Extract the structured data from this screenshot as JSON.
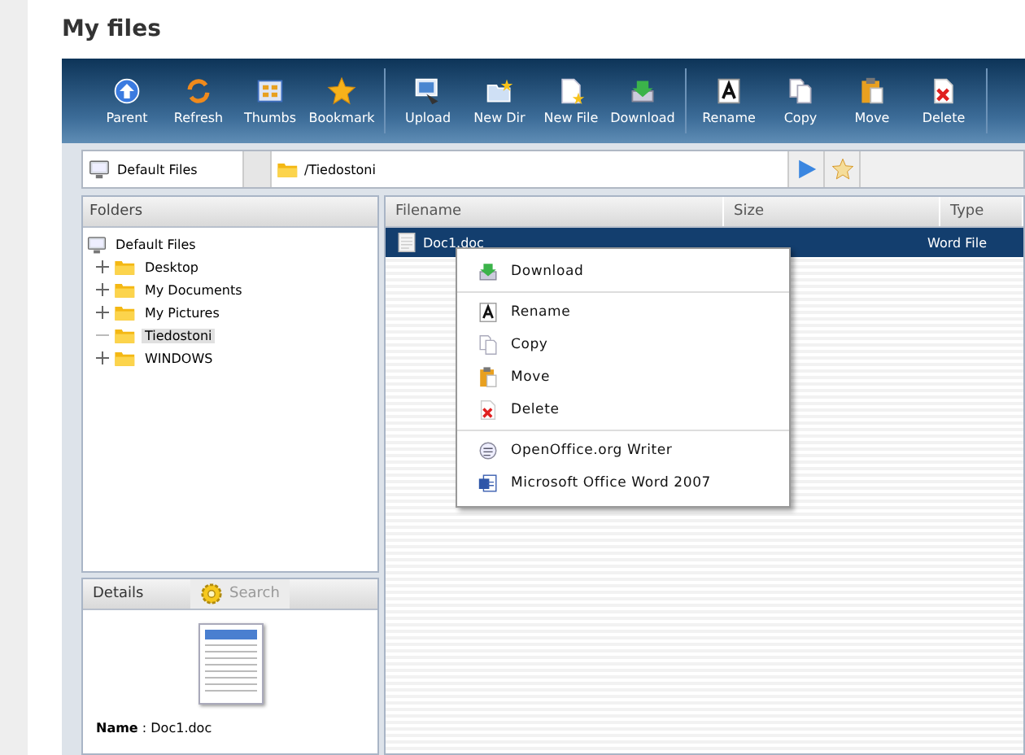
{
  "page_title": "My files",
  "toolbar": {
    "groups": [
      [
        {
          "label": "Parent",
          "kind": "parent"
        },
        {
          "label": "Refresh",
          "kind": "refresh"
        },
        {
          "label": "Thumbs",
          "kind": "thumbs"
        },
        {
          "label": "Bookmark",
          "kind": "bookmark"
        }
      ],
      [
        {
          "label": "Upload",
          "kind": "upload"
        },
        {
          "label": "New Dir",
          "kind": "newdir"
        },
        {
          "label": "New File",
          "kind": "newfile"
        },
        {
          "label": "Download",
          "kind": "download"
        }
      ],
      [
        {
          "label": "Rename",
          "kind": "rename"
        },
        {
          "label": "Copy",
          "kind": "copy"
        },
        {
          "label": "Move",
          "kind": "move"
        },
        {
          "label": "Delete",
          "kind": "delete"
        }
      ]
    ]
  },
  "address": {
    "location": "Default Files",
    "path": "/Tiedostoni"
  },
  "folders": {
    "title": "Folders",
    "tree": {
      "label": "Default Files",
      "children": [
        {
          "label": "Desktop",
          "expandable": true,
          "selected": false
        },
        {
          "label": "My Documents",
          "expandable": true,
          "selected": false
        },
        {
          "label": "My Pictures",
          "expandable": true,
          "selected": false
        },
        {
          "label": "Tiedostoni",
          "expandable": false,
          "selected": true
        },
        {
          "label": "WINDOWS",
          "expandable": true,
          "selected": false
        }
      ]
    }
  },
  "details": {
    "tabs": [
      {
        "label": "Details",
        "selected": true
      },
      {
        "label": "Search",
        "selected": false
      }
    ],
    "name_label": "Name",
    "name_value": ": Doc1.doc"
  },
  "table": {
    "columns": [
      "Filename",
      "Size",
      "Type"
    ],
    "rows": [
      {
        "filename": "Doc1.doc",
        "size": "",
        "type": "Word File",
        "selected": true
      }
    ]
  },
  "context_menu": {
    "groups": [
      [
        {
          "label": "Download",
          "kind": "download"
        }
      ],
      [
        {
          "label": "Rename",
          "kind": "rename"
        },
        {
          "label": "Copy",
          "kind": "copy"
        },
        {
          "label": "Move",
          "kind": "move"
        },
        {
          "label": "Delete",
          "kind": "delete"
        }
      ],
      [
        {
          "label": "OpenOffice.org Writer",
          "kind": "writer"
        },
        {
          "label": "Microsoft Office Word 2007",
          "kind": "word"
        }
      ]
    ]
  }
}
